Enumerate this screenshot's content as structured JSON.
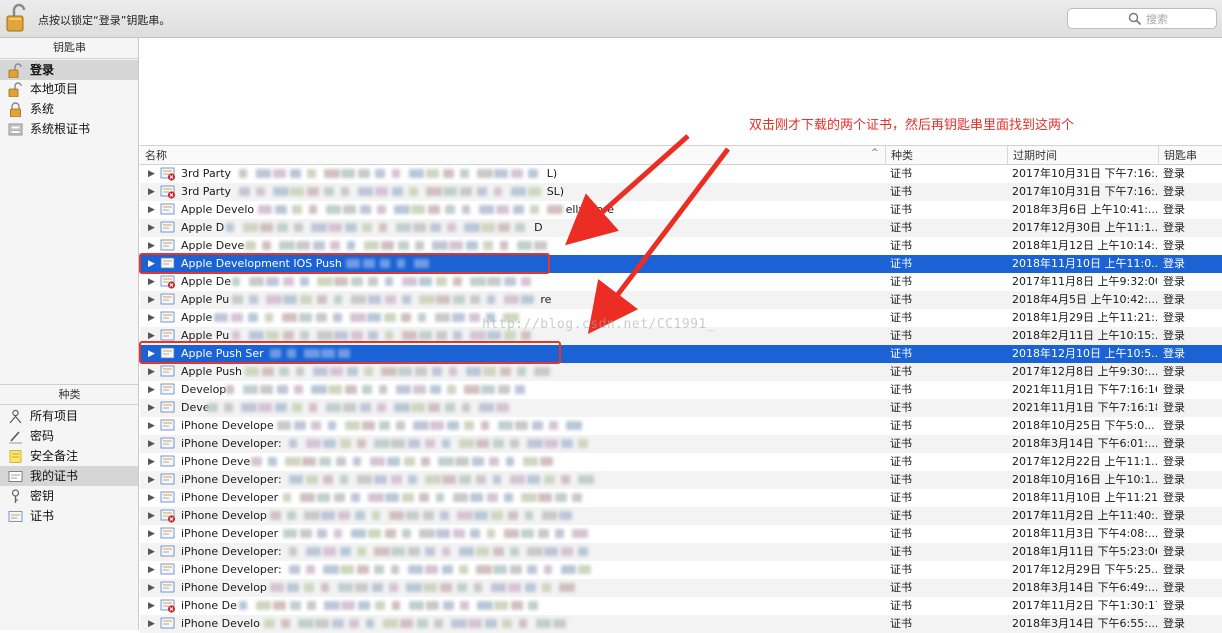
{
  "topbar": {
    "lock_text": "点按以锁定“登录”钥匙串。",
    "search_placeholder": "搜索"
  },
  "sidebar": {
    "keychains_title": "钥匙串",
    "keychains": [
      {
        "label": "登录",
        "icon": "lock-open-icon",
        "selected": true
      },
      {
        "label": "本地项目",
        "icon": "lock-open-icon",
        "selected": false
      },
      {
        "label": "系统",
        "icon": "lock-icon",
        "selected": false
      },
      {
        "label": "系统根证书",
        "icon": "cabinet-icon",
        "selected": false
      }
    ],
    "category_title": "种类",
    "categories": [
      {
        "label": "所有项目",
        "icon": "people-icon",
        "selected": false
      },
      {
        "label": "密码",
        "icon": "pen-icon",
        "selected": false
      },
      {
        "label": "安全备注",
        "icon": "note-icon",
        "selected": false
      },
      {
        "label": "我的证书",
        "icon": "my-certificate-icon",
        "selected": true
      },
      {
        "label": "密钥",
        "icon": "key-icon",
        "selected": false
      },
      {
        "label": "证书",
        "icon": "certificate-icon",
        "selected": false
      }
    ]
  },
  "table": {
    "columns": {
      "name": "名称",
      "kind": "种类",
      "expires": "过期时间",
      "keychain": "钥匙串"
    },
    "rows": [
      {
        "name": "3rd Party",
        "kind": "证书",
        "expires": "2017年10月31日 下午7:16:...",
        "keychain": "登录",
        "invalid": true,
        "tail": "L)"
      },
      {
        "name": "3rd Party",
        "kind": "证书",
        "expires": "2017年10月31日 下午7:16:...",
        "keychain": "登录",
        "invalid": true,
        "tail": "SL)"
      },
      {
        "name": "Apple Develo",
        "kind": "证书",
        "expires": "2018年3月6日 上午10:41:...",
        "keychain": "登录",
        "invalid": false,
        "tail": "ellyStore"
      },
      {
        "name": "Apple D",
        "kind": "证书",
        "expires": "2017年12月30日 上午11:1...",
        "keychain": "登录",
        "invalid": false,
        "tail": "D"
      },
      {
        "name": "Apple Deve",
        "kind": "证书",
        "expires": "2018年1月12日 上午10:14:...",
        "keychain": "登录",
        "invalid": false,
        "tail": ""
      },
      {
        "name": "Apple Development IOS Push",
        "kind": "证书",
        "expires": "2018年11月10日 上午11:0...",
        "keychain": "登录",
        "invalid": false,
        "tail": "",
        "selected": true
      },
      {
        "name": "Apple De",
        "kind": "证书",
        "expires": "2017年11月8日 上午9:32:00",
        "keychain": "登录",
        "invalid": true,
        "tail": ""
      },
      {
        "name": "Apple Pu",
        "kind": "证书",
        "expires": "2018年4月5日 上午10:42:...",
        "keychain": "登录",
        "invalid": false,
        "tail": "re"
      },
      {
        "name": "Apple",
        "kind": "证书",
        "expires": "2018年1月29日 上午11:21:...",
        "keychain": "登录",
        "invalid": false,
        "tail": ""
      },
      {
        "name": "Apple Pu",
        "kind": "证书",
        "expires": "2018年2月11日 上午10:15:...",
        "keychain": "登录",
        "invalid": false,
        "tail": ""
      },
      {
        "name": "Apple Push Ser",
        "kind": "证书",
        "expires": "2018年12月10日 上午10:5...",
        "keychain": "登录",
        "invalid": false,
        "tail": "",
        "selected": true
      },
      {
        "name": "Apple Push",
        "kind": "证书",
        "expires": "2017年12月8日 上午9:30:...",
        "keychain": "登录",
        "invalid": false,
        "tail": ""
      },
      {
        "name": "Develop",
        "kind": "证书",
        "expires": "2021年11月1日 下午7:16:16",
        "keychain": "登录",
        "invalid": false,
        "tail": ""
      },
      {
        "name": "Deve",
        "kind": "证书",
        "expires": "2021年11月1日 下午7:16:18",
        "keychain": "登录",
        "invalid": false,
        "tail": ""
      },
      {
        "name": "iPhone Develope",
        "kind": "证书",
        "expires": "2018年10月25日 下午5:0...",
        "keychain": "登录",
        "invalid": false,
        "tail": ""
      },
      {
        "name": "iPhone Developer:",
        "kind": "证书",
        "expires": "2018年3月14日 下午6:01:...",
        "keychain": "登录",
        "invalid": false,
        "tail": ""
      },
      {
        "name": "iPhone Deve",
        "kind": "证书",
        "expires": "2017年12月22日 上午11:1...",
        "keychain": "登录",
        "invalid": false,
        "tail": ""
      },
      {
        "name": "iPhone Developer:",
        "kind": "证书",
        "expires": "2018年10月16日 上午10:1...",
        "keychain": "登录",
        "invalid": false,
        "tail": ""
      },
      {
        "name": "iPhone Developer",
        "kind": "证书",
        "expires": "2018年11月10日 上午11:21...",
        "keychain": "登录",
        "invalid": false,
        "tail": ""
      },
      {
        "name": "iPhone Develop",
        "kind": "证书",
        "expires": "2017年11月2日 上午11:40:...",
        "keychain": "登录",
        "invalid": true,
        "tail": ""
      },
      {
        "name": "iPhone Developer",
        "kind": "证书",
        "expires": "2018年11月3日 下午4:08:...",
        "keychain": "登录",
        "invalid": false,
        "tail": ""
      },
      {
        "name": "iPhone Developer:",
        "kind": "证书",
        "expires": "2018年1月11日 下午5:23:06",
        "keychain": "登录",
        "invalid": false,
        "tail": ""
      },
      {
        "name": "iPhone Developer:",
        "kind": "证书",
        "expires": "2017年12月29日 下午5:25...",
        "keychain": "登录",
        "invalid": false,
        "tail": ""
      },
      {
        "name": "iPhone Develop",
        "kind": "证书",
        "expires": "2018年3月14日 下午6:49:...",
        "keychain": "登录",
        "invalid": false,
        "tail": ""
      },
      {
        "name": "iPhone De",
        "kind": "证书",
        "expires": "2017年11月2日 下午1:30:17",
        "keychain": "登录",
        "invalid": true,
        "tail": ""
      },
      {
        "name": "iPhone Develo",
        "kind": "证书",
        "expires": "2018年3月14日 下午6:55:...",
        "keychain": "登录",
        "invalid": false,
        "tail": ""
      }
    ]
  },
  "annotation": {
    "text": "双击刚才下载的两个证书，然后再钥匙串里面找到这两个",
    "color": "#e4312b"
  },
  "watermark": "http://blog.csdn.net/CC1991_",
  "colors": {
    "selection": "#1b63d4",
    "annotation": "#e8332b"
  }
}
